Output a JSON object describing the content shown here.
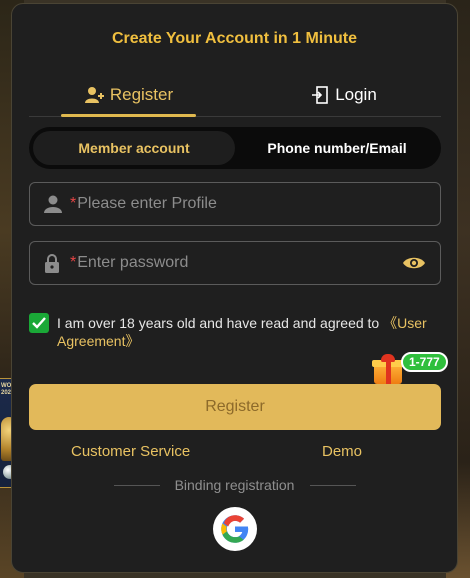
{
  "header": {
    "title": "Create Your Account in 1 Minute"
  },
  "tabs": [
    {
      "label": "Register",
      "icon": "add-user-icon",
      "active": true
    },
    {
      "label": "Login",
      "icon": "login-door-icon",
      "active": false
    }
  ],
  "account_type": {
    "options": [
      "Member account",
      "Phone number/Email"
    ],
    "selected": "Member account"
  },
  "form": {
    "profile": {
      "required_mark": "*",
      "placeholder": "Please enter Profile",
      "icon": "user-icon"
    },
    "password": {
      "required_mark": "*",
      "placeholder": "Enter password",
      "icon": "lock-icon",
      "toggle_icon": "eye-icon"
    }
  },
  "agreement": {
    "checked": true,
    "text": "I am over 18 years old and have read and agreed to ",
    "link": "《User Agreement》"
  },
  "promo": {
    "badge": "1-777",
    "icon": "gift-icon"
  },
  "actions": {
    "register_label": "Register",
    "customer_service": "Customer Service",
    "demo": "Demo"
  },
  "binding": {
    "label": "Binding registration",
    "providers": [
      "google"
    ]
  },
  "side_banner": {
    "text": "WORLD 2026"
  },
  "colors": {
    "accent": "#e8c262",
    "button": "#e2b95a",
    "check": "#1aa837",
    "required": "#e54545"
  }
}
